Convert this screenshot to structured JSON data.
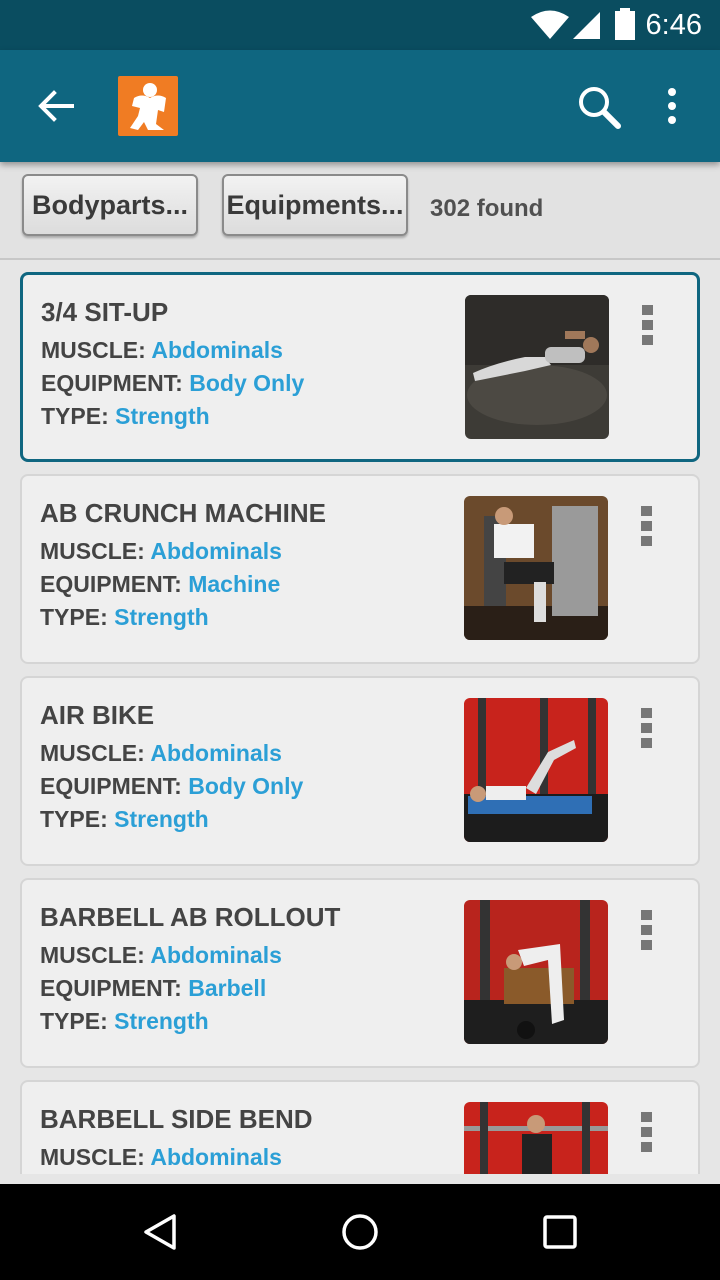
{
  "status_bar": {
    "time": "6:46"
  },
  "app_bar": {
    "back_icon": "arrow-left-icon",
    "logo_icon": "bodybuilder-logo",
    "search_icon": "search-icon",
    "menu_icon": "more-vert-icon"
  },
  "filters": {
    "bodyparts_label": "Bodyparts...",
    "equipments_label": "Equipments...",
    "found_text": "302 found"
  },
  "labels": {
    "muscle": "MUSCLE:",
    "equipment": "EQUIPMENT:",
    "type": "TYPE:"
  },
  "exercises": [
    {
      "name": "3/4 SIT-UP",
      "muscle": "Abdominals",
      "equipment": "Body Only",
      "type": "Strength",
      "selected": true
    },
    {
      "name": "AB CRUNCH MACHINE",
      "muscle": "Abdominals",
      "equipment": "Machine",
      "type": "Strength"
    },
    {
      "name": "AIR BIKE",
      "muscle": "Abdominals",
      "equipment": "Body Only",
      "type": "Strength"
    },
    {
      "name": "BARBELL AB ROLLOUT",
      "muscle": "Abdominals",
      "equipment": "Barbell",
      "type": "Strength"
    },
    {
      "name": "BARBELL SIDE BEND",
      "muscle": "Abdominals"
    }
  ],
  "colors": {
    "status_bar": "#0a4d60",
    "app_bar": "#0f6680",
    "logo": "#f07c23",
    "value_text": "#2b9fd6"
  }
}
